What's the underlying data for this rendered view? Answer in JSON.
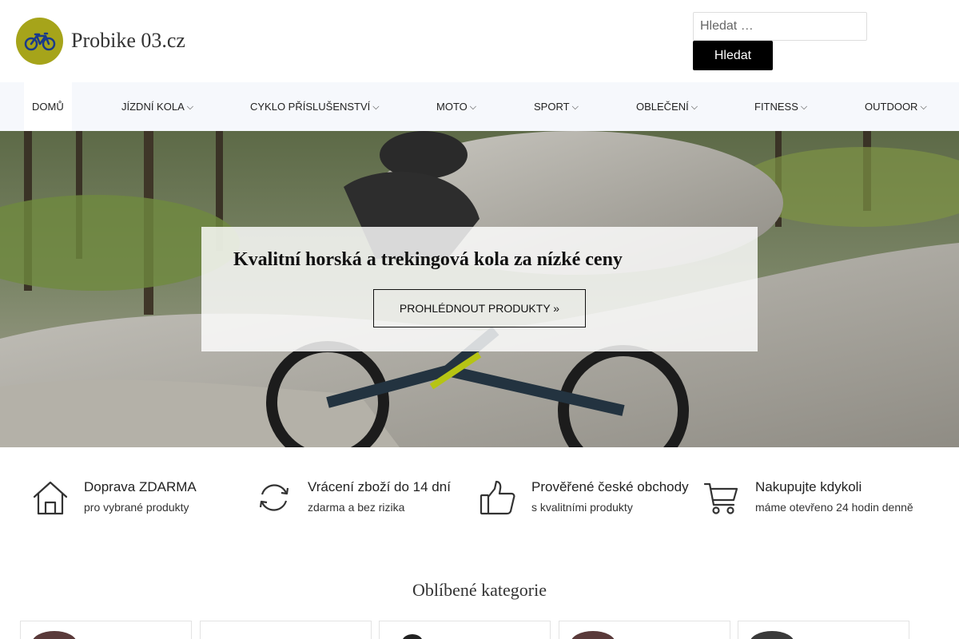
{
  "header": {
    "site_title": "Probike 03.cz",
    "logo_icon": "bicycle-icon",
    "logo_color": "#a6a41a",
    "search_placeholder": "Hledat …",
    "search_button": "Hledat"
  },
  "nav": {
    "items": [
      {
        "label": "Domů",
        "active": true,
        "dropdown": false
      },
      {
        "label": "Jízdní kola",
        "dropdown": true
      },
      {
        "label": "Cyklo příslušenství",
        "dropdown": true
      },
      {
        "label": "Moto",
        "dropdown": true
      },
      {
        "label": "Sport",
        "dropdown": true
      },
      {
        "label": "Oblečení",
        "dropdown": true
      },
      {
        "label": "Fitness",
        "dropdown": true
      },
      {
        "label": "Outdoor",
        "dropdown": true
      }
    ],
    "chevron": "⌵"
  },
  "hero": {
    "title": "Kvalitní horská a trekingová kola za nízké ceny",
    "button": "PROHLÉDNOUT PRODUKTY »"
  },
  "features": [
    {
      "icon": "house-icon",
      "title": "Doprava ZDARMA",
      "subtitle": "pro vybrané produkty"
    },
    {
      "icon": "refresh-icon",
      "title": "Vrácení zboží do 14 dní",
      "subtitle": "zdarma a bez rizika"
    },
    {
      "icon": "thumbs-up-icon",
      "title": "Prověřené české obchody",
      "subtitle": "s kvalitními produkty"
    },
    {
      "icon": "shopping-cart-icon",
      "title": "Nakupujte kdykoli",
      "subtitle": "máme otevřeno 24 hodin denně"
    }
  ],
  "categories": {
    "heading": "Oblíbené kategorie"
  }
}
